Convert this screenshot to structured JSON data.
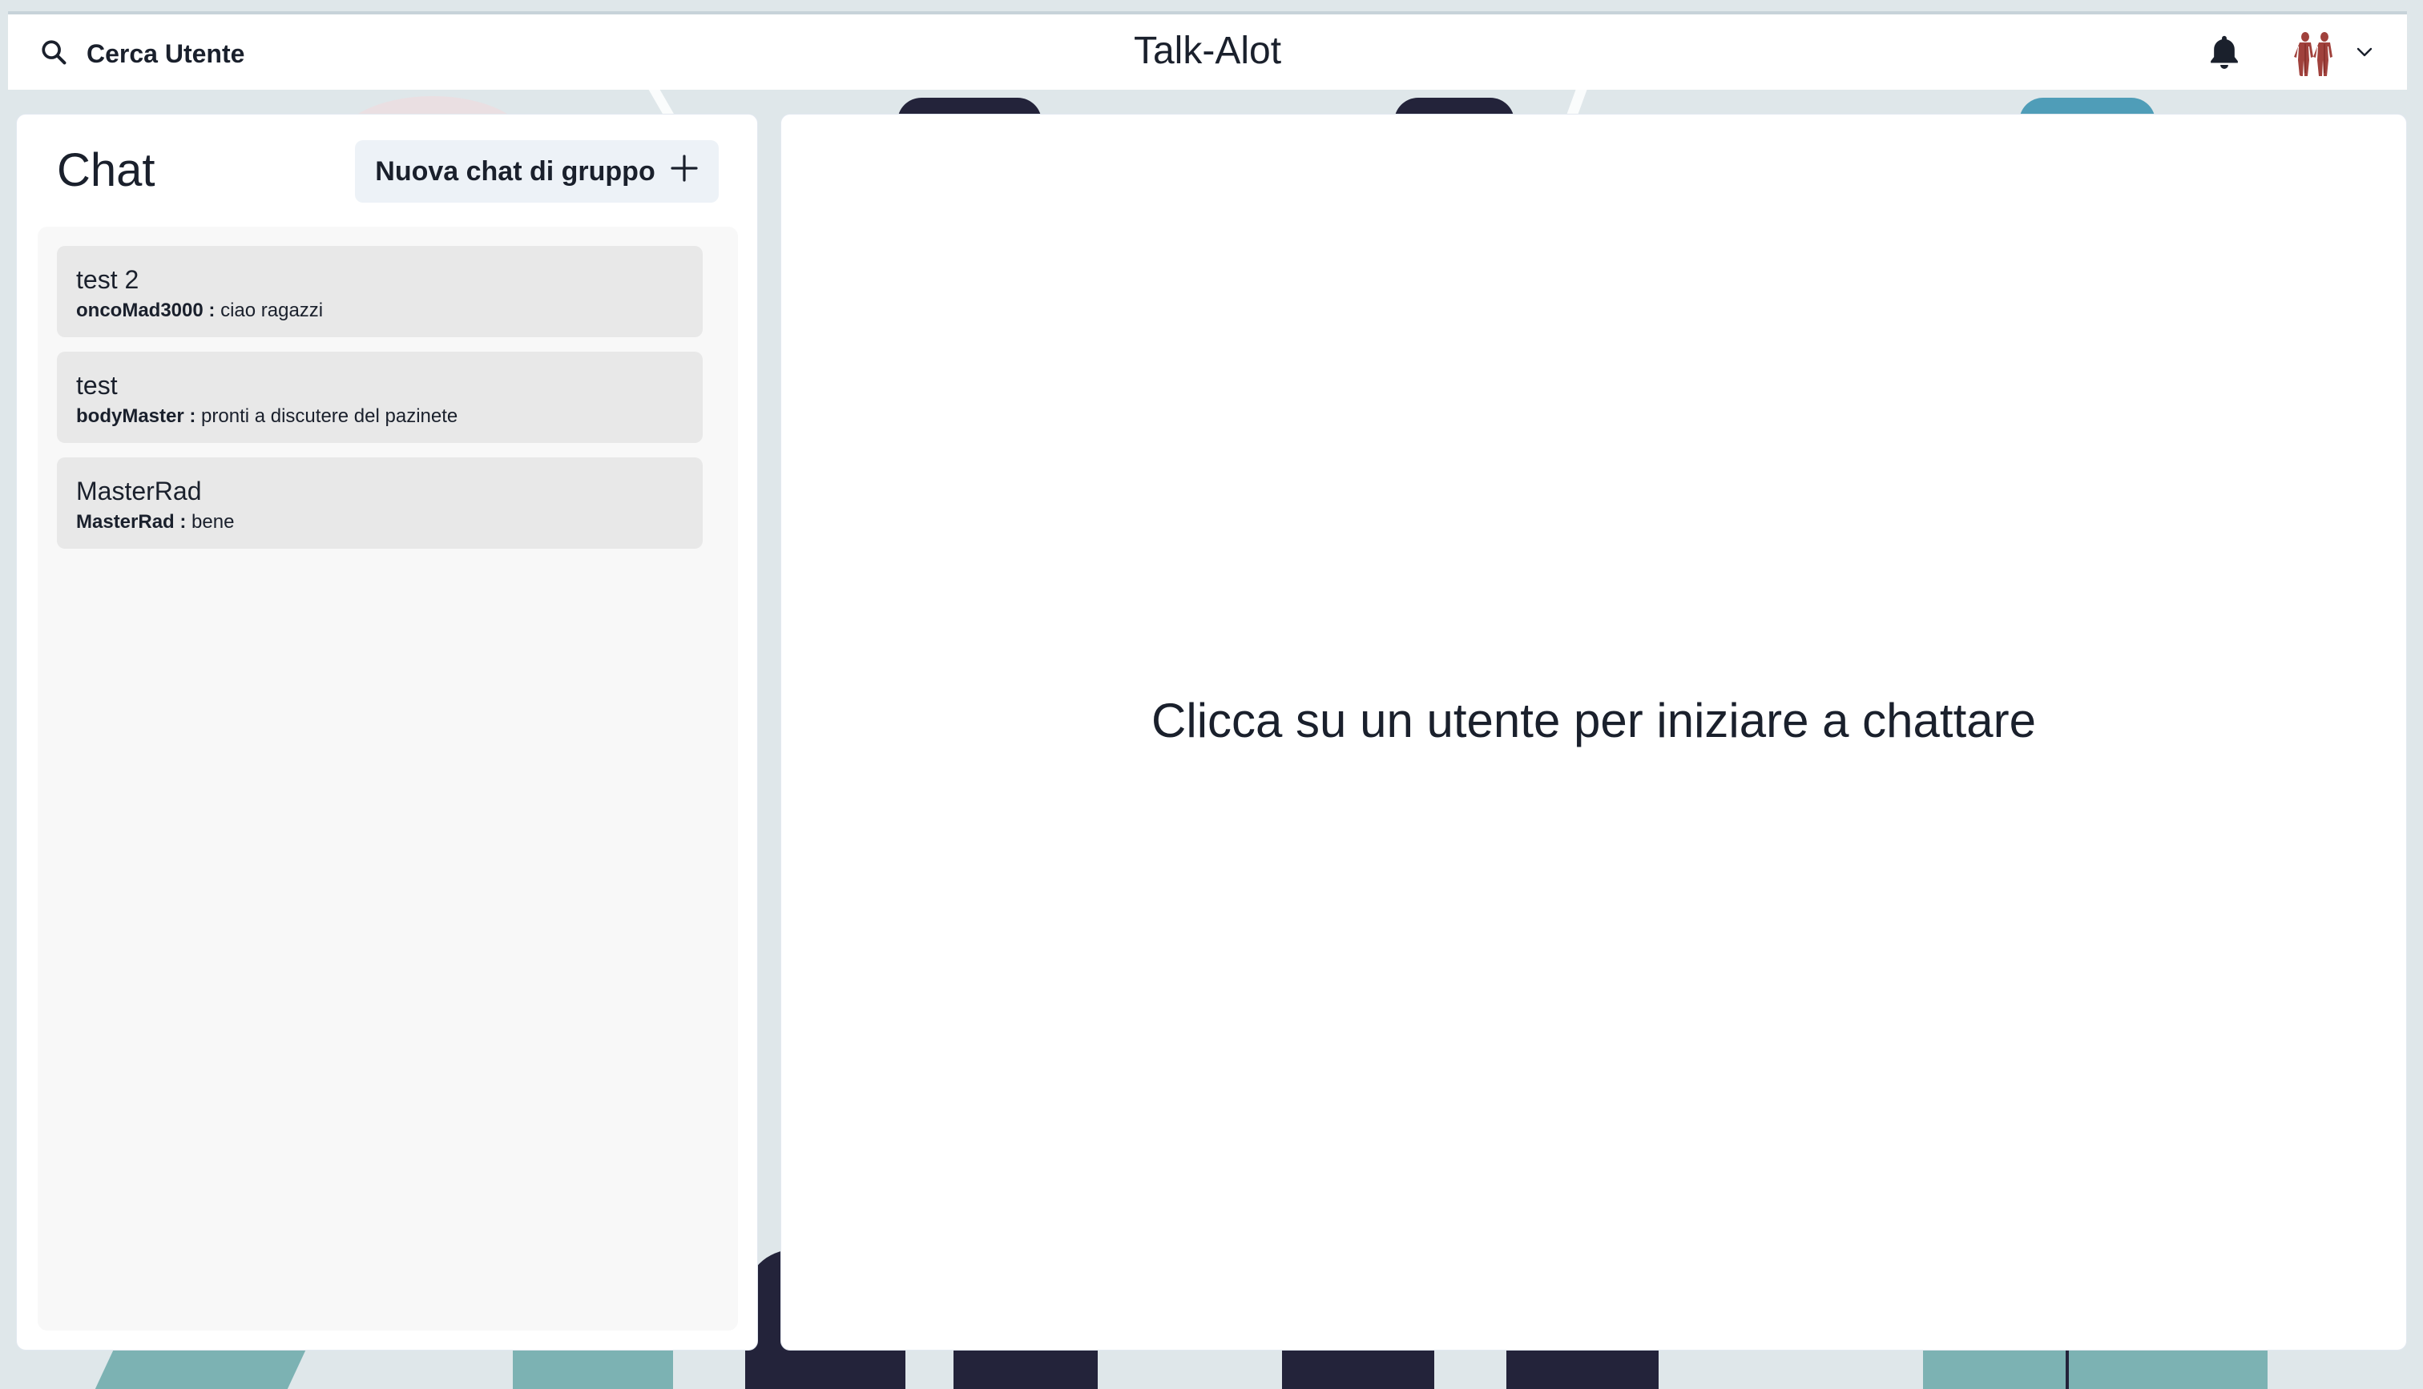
{
  "header": {
    "search_label": "Cerca Utente",
    "app_title": "Talk-Alot"
  },
  "sidebar": {
    "title": "Chat",
    "new_group_label": "Nuova chat di gruppo",
    "chats": [
      {
        "name": "test 2",
        "sender": "oncoMad3000 :",
        "message": "ciao ragazzi"
      },
      {
        "name": "test",
        "sender": "bodyMaster :",
        "message": "pronti a discutere del pazinete"
      },
      {
        "name": "MasterRad",
        "sender": "MasterRad :",
        "message": "bene"
      }
    ]
  },
  "main": {
    "empty_message": "Clicca su un utente per iniziare a chattare"
  },
  "icons": {
    "search": "search-icon",
    "bell": "bell-icon",
    "plus": "plus-icon",
    "chevron": "chevron-down-icon"
  }
}
